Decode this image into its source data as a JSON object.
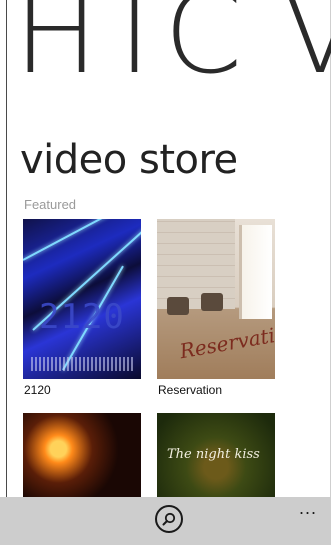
{
  "panorama": {
    "title": "HTC V"
  },
  "section": {
    "title": "video store",
    "subtitle": "Featured"
  },
  "items": [
    {
      "label": "2120",
      "poster_text": "2120"
    },
    {
      "label": "Reservation",
      "poster_text": "Reservation"
    },
    {
      "label": "",
      "poster_text": ""
    },
    {
      "label": "",
      "poster_text": "The night kiss"
    }
  ],
  "appbar": {
    "more": "..."
  },
  "icons": {
    "search": "search-icon",
    "more": "ellipsis-icon"
  },
  "colors": {
    "appbar": "#cdcdcd",
    "text": "#222222",
    "subtle": "#9a9a9a"
  }
}
